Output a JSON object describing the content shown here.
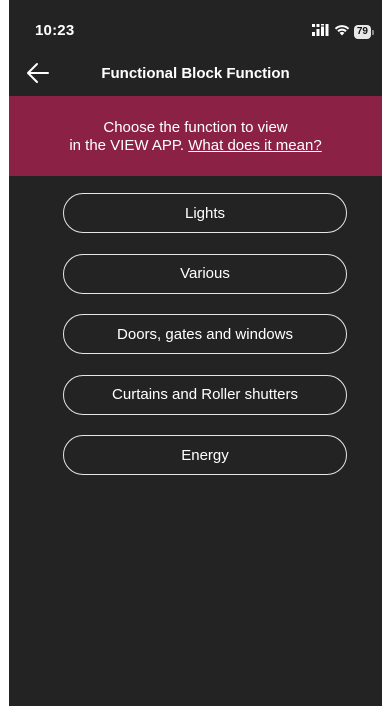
{
  "status_bar": {
    "time": "10:23",
    "battery_level": "79",
    "icons": [
      "signal-icon",
      "wifi-icon",
      "battery-icon"
    ]
  },
  "nav": {
    "back_icon": "arrow-left-icon",
    "title": "Functional Block Function"
  },
  "banner": {
    "line1": "Choose the function to view",
    "line2_prefix": "in the VIEW APP. ",
    "link_text": "What does it mean?",
    "background_color": "#8c2146"
  },
  "functions": [
    {
      "label": "Lights"
    },
    {
      "label": "Various"
    },
    {
      "label": "Doors, gates and windows"
    },
    {
      "label": "Curtains and Roller shutters"
    },
    {
      "label": "Energy"
    }
  ],
  "colors": {
    "background": "#232323",
    "text": "#ffffff",
    "button_border": "#e6e6e6"
  }
}
